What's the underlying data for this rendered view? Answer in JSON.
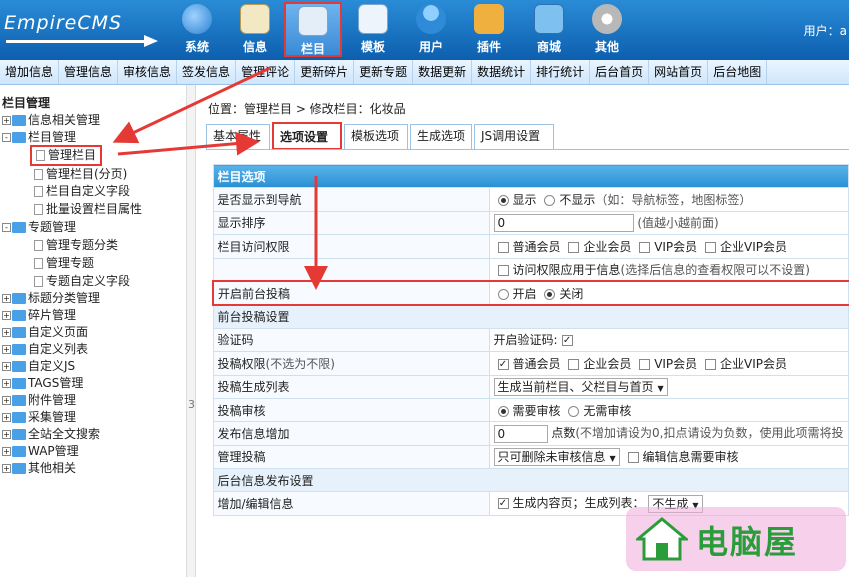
{
  "logo": "EmpireCMS",
  "topnav": [
    {
      "label": "系统",
      "icon": "globe-icon",
      "color": "#3b8fe0"
    },
    {
      "label": "信息",
      "icon": "document-pen-icon",
      "color": "#e8d9a8"
    },
    {
      "label": "栏目",
      "icon": "folder-icon",
      "color": "#d8e8f8"
    },
    {
      "label": "模板",
      "icon": "template-icon",
      "color": "#e8f0f8"
    },
    {
      "label": "用户",
      "icon": "user-icon",
      "color": "#5ab0e8"
    },
    {
      "label": "插件",
      "icon": "tools-icon",
      "color": "#e8a23a"
    },
    {
      "label": "商城",
      "icon": "shop-icon",
      "color": "#5aa0d8"
    },
    {
      "label": "其他",
      "icon": "gear-icon",
      "color": "#c8c8c8"
    }
  ],
  "user_label": "用户：a",
  "menu": [
    "增加信息",
    "管理信息",
    "审核信息",
    "签发信息",
    "管理评论",
    "更新碎片",
    "更新专题",
    "数据更新",
    "数据统计",
    "排行统计",
    "后台首页",
    "网站首页",
    "后台地图"
  ],
  "tree": {
    "root": "栏目管理",
    "items": [
      {
        "label": "信息相关管理",
        "kind": "folder",
        "exp": "+"
      },
      {
        "label": "栏目管理",
        "kind": "folder",
        "exp": "-"
      },
      {
        "label": "管理栏目",
        "kind": "file"
      },
      {
        "label": "管理栏目(分页)",
        "kind": "file"
      },
      {
        "label": "栏目自定义字段",
        "kind": "file"
      },
      {
        "label": "批量设置栏目属性",
        "kind": "file"
      },
      {
        "label": "专题管理",
        "kind": "folder",
        "exp": "-"
      },
      {
        "label": "管理专题分类",
        "kind": "file"
      },
      {
        "label": "管理专题",
        "kind": "file"
      },
      {
        "label": "专题自定义字段",
        "kind": "file"
      },
      {
        "label": "标题分类管理",
        "kind": "folder",
        "exp": "+"
      },
      {
        "label": "碎片管理",
        "kind": "folder",
        "exp": "+"
      },
      {
        "label": "自定义页面",
        "kind": "folder",
        "exp": "+"
      },
      {
        "label": "自定义列表",
        "kind": "folder",
        "exp": "+"
      },
      {
        "label": "自定义JS",
        "kind": "folder",
        "exp": "+"
      },
      {
        "label": "TAGS管理",
        "kind": "folder",
        "exp": "+"
      },
      {
        "label": "附件管理",
        "kind": "folder",
        "exp": "+"
      },
      {
        "label": "采集管理",
        "kind": "folder",
        "exp": "+"
      },
      {
        "label": "全站全文搜索",
        "kind": "folder",
        "exp": "+"
      },
      {
        "label": "WAP管理",
        "kind": "folder",
        "exp": "+"
      },
      {
        "label": "其他相关",
        "kind": "folder",
        "exp": "+"
      }
    ]
  },
  "splitter_label": "3",
  "breadcrumb": "位置：管理栏目 > 修改栏目：化妆品",
  "tabs": [
    "基本属性",
    "选项设置",
    "模板选项",
    "生成选项",
    "JS调用设置"
  ],
  "form": {
    "section1": "栏目选项",
    "nav_label": "是否显示到导航",
    "nav_opt_show": "显示",
    "nav_opt_hide": "不显示",
    "nav_note": "（如：导航标签，地图标签）",
    "order_label": "显示排序",
    "order_value": "0",
    "order_note": "(值越小越前面)",
    "access_label": "栏目访问权限",
    "groups": [
      "普通会员",
      "企业会员",
      "VIP会员",
      "企业VIP会员"
    ],
    "access_apply": "访问权限应用于信息",
    "access_apply_note": "(选择后信息的查看权限可以不设置)",
    "submit_label": "开启前台投稿",
    "submit_on": "开启",
    "submit_off": "关闭",
    "section2": "前台投稿设置",
    "captcha_label": "验证码",
    "captcha_opt": "开启验证码:",
    "perm_label": "投稿权限",
    "perm_note": "(不选为不限)",
    "gen_label": "投稿生成列表",
    "gen_value": "生成当前栏目、父栏目与首页",
    "review_label": "投稿审核",
    "review_need": "需要审核",
    "review_none": "无需审核",
    "points_label": "发布信息增加",
    "points_value": "0",
    "points_unit": "点数",
    "points_note": "(不增加请设为0,扣点请设为负数，使用此项需将投",
    "manage_label": "管理投稿",
    "manage_value": "只可删除未审核信息",
    "manage_check": "编辑信息需要审核",
    "section3": "后台信息发布设置",
    "edit_label": "增加/编辑信息",
    "edit_opt": "生成内容页；生成列表：",
    "edit_select": "不生成"
  },
  "watermark": "电脑屋",
  "colors": {
    "header": "#1a73c4",
    "accent_red": "#e53935",
    "section": "#3a9ad8"
  }
}
